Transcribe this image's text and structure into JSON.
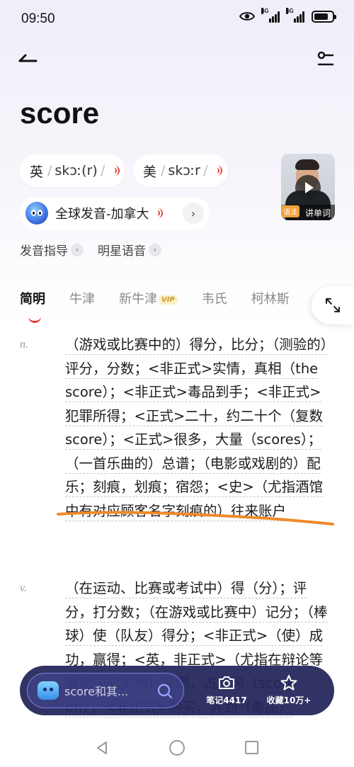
{
  "status": {
    "time": "09:50",
    "network1": "4G",
    "network2": "4G"
  },
  "word": "score",
  "pronunciations": [
    {
      "lang": "英",
      "ipa": "skɔː(r)"
    },
    {
      "lang": "美",
      "ipa": "skɔːr"
    }
  ],
  "global_pron": "全球发音-加拿大",
  "video": {
    "caption": "讲单词",
    "tag": "语法"
  },
  "links": [
    "发音指导",
    "明星语音"
  ],
  "tabs": [
    {
      "label": "简明"
    },
    {
      "label": "牛津"
    },
    {
      "label": "新牛津",
      "badge": "VIP"
    },
    {
      "label": "韦氏"
    },
    {
      "label": "柯林斯"
    }
  ],
  "definitions": [
    {
      "pos": "n.",
      "text": "（游戏或比赛中的）得分，比分；（测验的）评分，分数；<非正式>实情，真相（the score）；<非正式>毒品到手；<非正式>犯罪所得；<正式>二十，约二十个（复数 score）；<正式>很多，大量（scores）；（一首乐曲的）总谱；（电影或戏剧的）配乐；刻痕，划痕；宿怨；<史>（尤指酒馆中有对应顾客名字刻痕的）往来账户"
    },
    {
      "pos": "v.",
      "text": "（在运动、比赛或考试中）得（分）；评分，打分数；（在游戏或比赛中）记分；（棒球）使（队友）得分；<非正式>（使）成功，赢得；<英，非正式>（尤指在辩论等活动中机灵地）驳倒，占上风（score off）；<非正式>购买，弄到（毒品）"
    }
  ],
  "bottom_bar": {
    "search_placeholder": "score和其...",
    "notes_label": "笔记4417",
    "fav_label": "收藏10万+"
  },
  "colors": {
    "accent": "#e53935",
    "highlight_stroke": "#f08a2a",
    "bottom_bar": "#24265a"
  }
}
